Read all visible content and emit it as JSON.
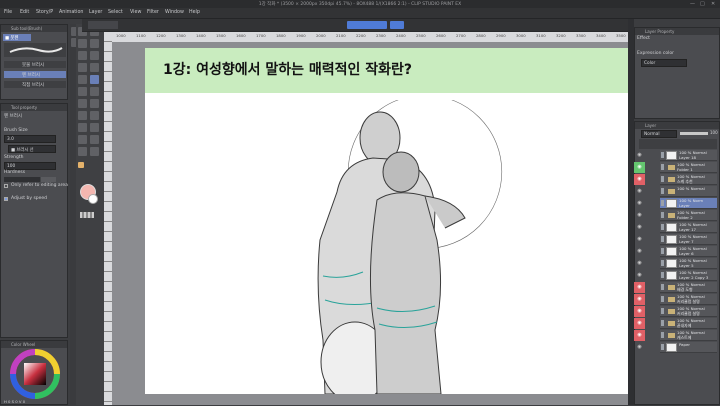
{
  "app": {
    "title": "1강 작화 * (3500 × 2000px 350dpi 45.7%)  - 8OX488 1/(X1866 2:1) - CLIP STUDIO PAINT EX",
    "window_controls": [
      "—",
      "□",
      "✕"
    ]
  },
  "menu": [
    "File",
    "Edit",
    "Story/P",
    "Animation",
    "Layer",
    "Select",
    "View",
    "Filter",
    "Window",
    "Help"
  ],
  "ruler_ticks": [
    "1000",
    "1100",
    "1200",
    "1300",
    "1400",
    "1500",
    "1600",
    "1700",
    "1800",
    "1900",
    "2000",
    "2100",
    "2200",
    "2300",
    "2400",
    "2500",
    "2600",
    "2700",
    "2800",
    "2900",
    "3000",
    "3100",
    "3200",
    "3300",
    "3400",
    "3500"
  ],
  "sub_tool": {
    "header": "Sub tool(Brush)",
    "active_tab": "■ 붓펜",
    "brushes": [
      "펜 브러시",
      "붓물 브러시",
      "직접 브러시"
    ],
    "selected": "펜 브러시"
  },
  "tool_property": {
    "header": "Tool property",
    "tool_name": "펜 브러시",
    "brush_size_label": "Brush Size",
    "brush_size_value": "3.0",
    "strength_label": "Strength",
    "strength_value": "100",
    "hardness_label": "Hardness",
    "opacity_field": "■ 브러시 선",
    "refer_label": "Only refer to editing area",
    "refer_checked": false,
    "adjust_label": "Adjust by speed",
    "adjust_checked": true
  },
  "color_wheel": {
    "header": "Color Wheel",
    "readout": "H 0  S 0  V 0"
  },
  "canvas": {
    "banner_text": "1강: 여성향에서 말하는 매력적인 작화란?",
    "banner_color": "#c9ecbf"
  },
  "layer_property": {
    "header": "Layer Property",
    "effect_label": "Effect",
    "expression_label": "Expression color",
    "expression_value": "Color"
  },
  "layer_panel": {
    "header": "Layer",
    "blend_mode": "Normal",
    "opacity": "100",
    "layers": [
      {
        "label": "100 % Normal\nLayer 18",
        "kind": "layer",
        "eye": "plain"
      },
      {
        "label": "100 % Normal\nFolder 1",
        "kind": "folder",
        "eye": "green"
      },
      {
        "label": "100 % Normal\n스케 추천",
        "kind": "folder",
        "eye": "red"
      },
      {
        "label": "100 % Normal\n",
        "kind": "folder",
        "eye": "plain"
      },
      {
        "label": "100 % Norm\nLayer",
        "kind": "layer",
        "eye": "plain",
        "selected": true
      },
      {
        "label": "100 % Normal\nFolder 2",
        "kind": "folder",
        "eye": "plain"
      },
      {
        "label": "100 % Normal\nLayer 17",
        "kind": "layer",
        "eye": "plain"
      },
      {
        "label": "100 % Normal\nLayer 7",
        "kind": "layer",
        "eye": "plain"
      },
      {
        "label": "100 % Normal\nLayer 6",
        "kind": "layer",
        "eye": "plain"
      },
      {
        "label": "100 % Normal\nLayer 5",
        "kind": "layer",
        "eye": "plain"
      },
      {
        "label": "100 % Normal\nLayer 2 Copy 3",
        "kind": "layer",
        "eye": "plain"
      },
      {
        "label": "100 % Normal\n배경 도형",
        "kind": "folder",
        "eye": "red"
      },
      {
        "label": "100 % Normal\n커리큘럼 설명",
        "kind": "folder",
        "eye": "red"
      },
      {
        "label": "100 % Normal\n커리큘럼 설명",
        "kind": "folder",
        "eye": "red"
      },
      {
        "label": "100 % Normal\n끝내자에",
        "kind": "folder",
        "eye": "red"
      },
      {
        "label": "100 % Normal\n캐스트에",
        "kind": "folder",
        "eye": "red"
      },
      {
        "label": "Paper",
        "kind": "paper",
        "eye": "plain"
      }
    ]
  }
}
